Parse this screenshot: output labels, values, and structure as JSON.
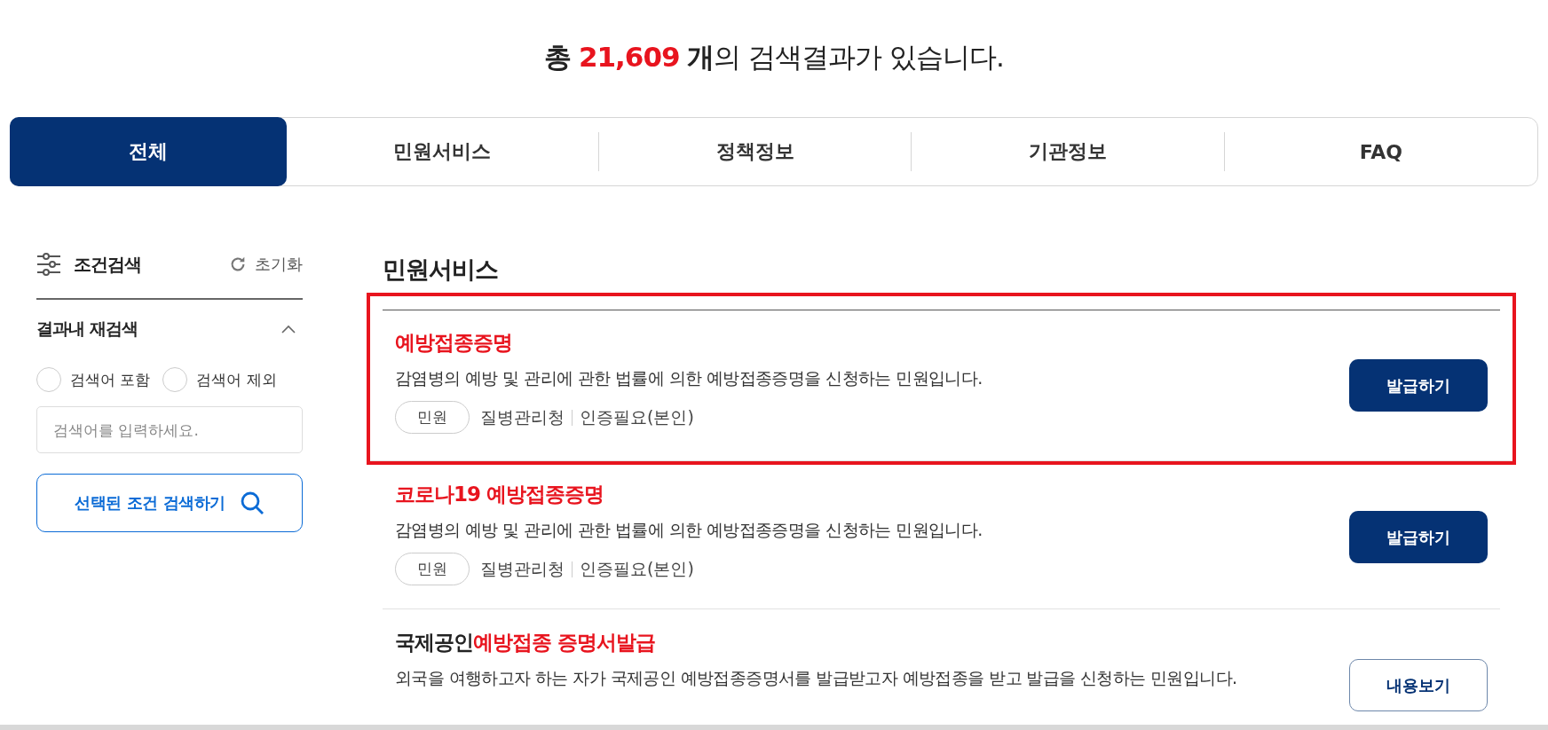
{
  "summary": {
    "prefix": "총",
    "count": "21,609",
    "unit": "개",
    "rest": "의 검색결과가 있습니다."
  },
  "tabs": [
    {
      "label": "전체",
      "selected": true
    },
    {
      "label": "민원서비스",
      "selected": false
    },
    {
      "label": "정책정보",
      "selected": false
    },
    {
      "label": "기관정보",
      "selected": false
    },
    {
      "label": "FAQ",
      "selected": false
    }
  ],
  "sidebar": {
    "title": "조건검색",
    "reset": "초기화",
    "section": {
      "title": "결과내 재검색",
      "expanded": true
    },
    "options": [
      {
        "label": "검색어 포함",
        "selected": false
      },
      {
        "label": "검색어 제외",
        "selected": false
      }
    ],
    "search": {
      "placeholder": "검색어를 입력하세요."
    },
    "submit": "선택된 조건 검색하기"
  },
  "results": {
    "heading": "민원서비스",
    "items": [
      {
        "title": [
          {
            "text": "예방접종증명",
            "highlight": true
          }
        ],
        "description": "감염병의 예방 및 관리에 관한 법률에 의한 예방접종증명을 신청하는 민원입니다.",
        "tag": "민원",
        "agency": "질병관리청",
        "auth": "인증필요(본인)",
        "button": {
          "label": "발급하기",
          "kind": "primary"
        },
        "highlighted": true
      },
      {
        "title": [
          {
            "text": "코로나19 예방접종증명",
            "highlight": true
          }
        ],
        "description": "감염병의 예방 및 관리에 관한 법률에 의한 예방접종증명을 신청하는 민원입니다.",
        "tag": "민원",
        "agency": "질병관리청",
        "auth": "인증필요(본인)",
        "button": {
          "label": "발급하기",
          "kind": "primary"
        },
        "highlighted": false
      },
      {
        "title": [
          {
            "text": "국제공인",
            "highlight": false
          },
          {
            "text": "예방접종 증명서발급",
            "highlight": true
          }
        ],
        "description": "외국을 여행하고자 하는 자가 국제공인 예방접종증명서를 발급받고자 예방접종을 받고 발급을 신청하는 민원입니다.",
        "button": {
          "label": "내용보기",
          "kind": "outline"
        },
        "highlighted": false
      }
    ]
  }
}
